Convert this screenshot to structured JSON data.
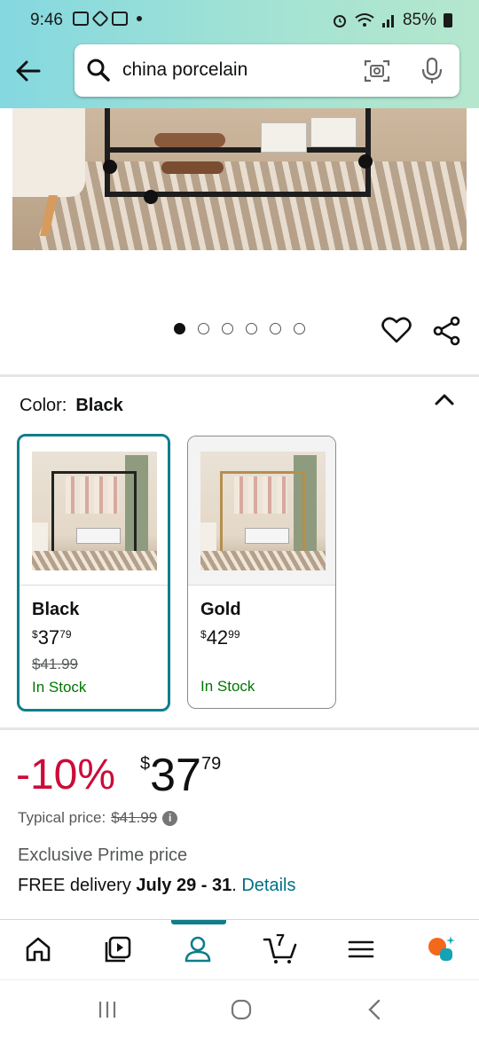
{
  "status_bar": {
    "time": "9:46",
    "battery": "85%"
  },
  "search": {
    "query": "china porcelain"
  },
  "carousel": {
    "total_images": 6,
    "active_index": 0
  },
  "color_section": {
    "label": "Color:",
    "selected": "Black",
    "options": [
      {
        "name": "Black",
        "price_symbol": "$",
        "price_whole": "37",
        "price_cents": "79",
        "list_price": "$41.99",
        "stock": "In Stock"
      },
      {
        "name": "Gold",
        "price_symbol": "$",
        "price_whole": "42",
        "price_cents": "99",
        "list_price": "",
        "stock": "In Stock"
      }
    ]
  },
  "pricing": {
    "discount": "-10%",
    "symbol": "$",
    "whole": "37",
    "cents": "79",
    "typical_label": "Typical price:",
    "typical_price": "$41.99",
    "prime_text": "Exclusive Prime price",
    "delivery_prefix": "FREE delivery",
    "delivery_dates": "July 29 - 31",
    "delivery_suffix": ".",
    "details_link": "Details"
  },
  "bottom_nav": {
    "cart_count": "7",
    "active": "account"
  },
  "colors": {
    "accent": "#0f7e8b",
    "discount": "#cc0c39",
    "stock": "#007600",
    "link": "#007185"
  }
}
